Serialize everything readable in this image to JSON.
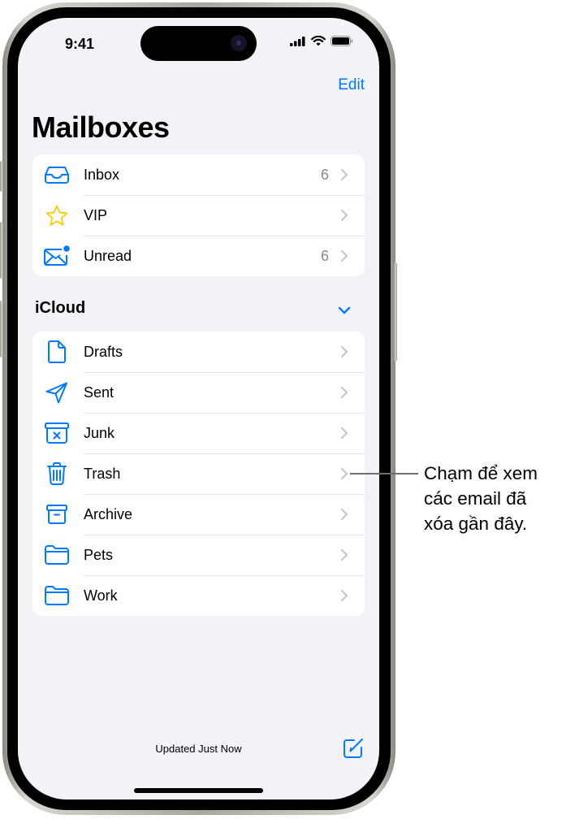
{
  "status_bar": {
    "time": "9:41",
    "icons": [
      "cellular-signal-icon",
      "wifi-icon",
      "battery-icon"
    ]
  },
  "nav": {
    "edit_label": "Edit",
    "title": "Mailboxes"
  },
  "colors": {
    "accent": "#007aff",
    "vip_star": "#ffcc00",
    "background": "#f2f2f7"
  },
  "smart_mailboxes": [
    {
      "label": "Inbox",
      "icon": "tray-icon",
      "count": "6"
    },
    {
      "label": "VIP",
      "icon": "star-icon",
      "count": ""
    },
    {
      "label": "Unread",
      "icon": "envelope-badge-icon",
      "count": "6"
    }
  ],
  "account": {
    "name": "iCloud",
    "expanded": true,
    "mailboxes": [
      {
        "label": "Drafts",
        "icon": "document-icon"
      },
      {
        "label": "Sent",
        "icon": "paper-plane-icon"
      },
      {
        "label": "Junk",
        "icon": "junk-bin-icon"
      },
      {
        "label": "Trash",
        "icon": "trash-icon"
      },
      {
        "label": "Archive",
        "icon": "archive-box-icon"
      },
      {
        "label": "Pets",
        "icon": "folder-icon"
      },
      {
        "label": "Work",
        "icon": "folder-icon"
      }
    ]
  },
  "toolbar": {
    "status": "Updated Just Now",
    "compose_icon": "compose-icon"
  },
  "callout": {
    "text": "Chạm để xem\ncác email đã\nxóa gần đây.",
    "target": "Trash"
  }
}
